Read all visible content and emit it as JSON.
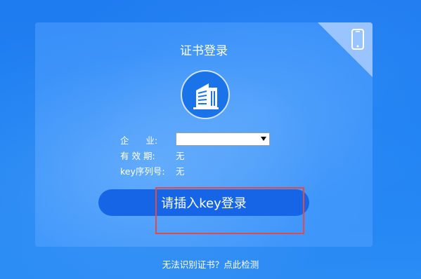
{
  "card": {
    "title": "证书登录",
    "corner_icon": "mobile-phone-icon",
    "logo_icon": "building-icon"
  },
  "form": {
    "company_label": "企      业:",
    "company_value": "",
    "validity_label": "有 效 期:",
    "validity_value": "无",
    "key_serial_label": "key序列号:",
    "key_serial_value": "无"
  },
  "login_button": {
    "label": "请插入key登录"
  },
  "footer": {
    "link_text": "无法识别证书？点此检测"
  },
  "colors": {
    "background": "#1f7cf0",
    "button": "#1565e6",
    "highlight_border": "#e04a4a"
  }
}
